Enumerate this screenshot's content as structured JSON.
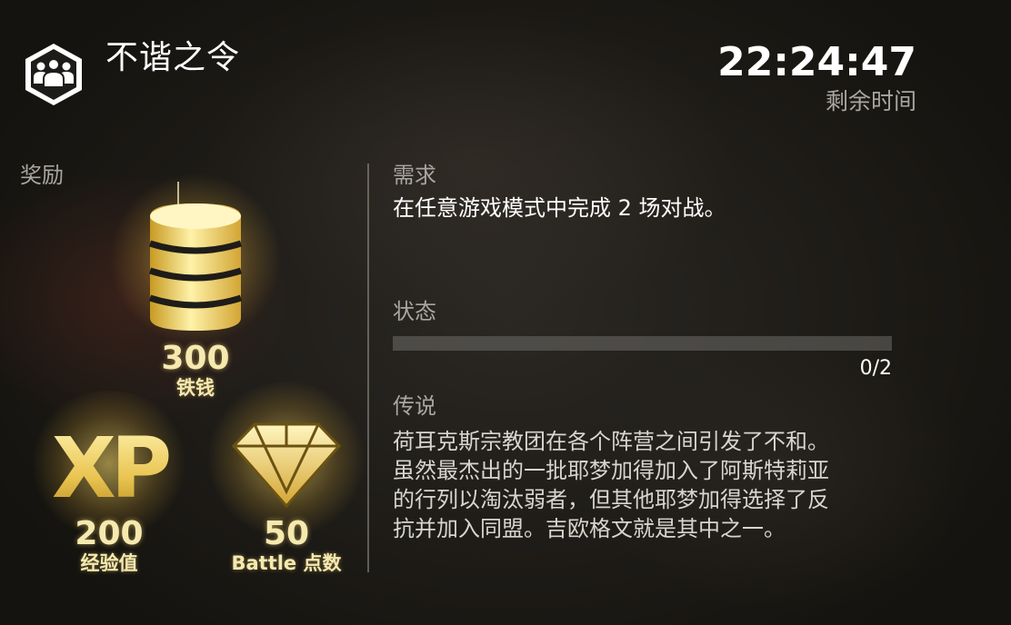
{
  "header": {
    "emblem_icon": "group-emblem-icon",
    "title": "不谐之令"
  },
  "timer": {
    "value": "22:24:47",
    "label": "剩余时间"
  },
  "rewards": {
    "heading": "奖励",
    "items": [
      {
        "icon": "coin-stack-icon",
        "amount": "300",
        "label": "铁钱"
      },
      {
        "icon": "xp-icon",
        "amount": "200",
        "label": "经验值"
      },
      {
        "icon": "diamond-icon",
        "amount": "50",
        "label": "Battle 点数"
      }
    ]
  },
  "requirement": {
    "heading": "需求",
    "text": "在任意游戏模式中完成 2 场对战。"
  },
  "status": {
    "heading": "状态",
    "progress_current": 0,
    "progress_total": 2,
    "progress_text": "0/2"
  },
  "lore": {
    "heading": "传说",
    "lines": [
      "荷耳克斯宗教团在各个阵营之间引发了不和。",
      "虽然最杰出的一批耶梦加得加入了阿斯特莉亚",
      "的行列以淘汰弱者，但其他耶梦加得选择了反",
      "抗并加入同盟。吉欧格文就是其中之一。"
    ]
  },
  "colors": {
    "gold": "#f5e9b0",
    "muted_label": "#a9a6a0",
    "progress_track": "#6e6c68"
  }
}
